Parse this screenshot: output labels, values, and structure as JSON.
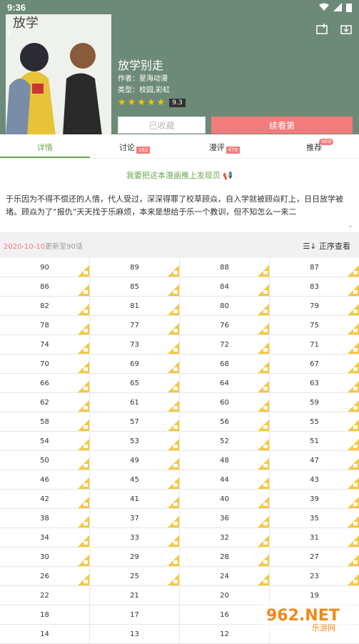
{
  "status": {
    "time": "9:36"
  },
  "header": {
    "title": "放学别走",
    "author": "作者：星海动漫",
    "genre": "类型：校园,彩虹",
    "score": "9.3",
    "fav_label": "已收藏",
    "continue_label": "续看第"
  },
  "tabs": [
    {
      "label": "详情"
    },
    {
      "label": "讨论",
      "badge": "162"
    },
    {
      "label": "漫评",
      "badge": "479"
    },
    {
      "label": "推荐",
      "badge": "NEW"
    }
  ],
  "promo": "我要把这本漫画推上发现页",
  "description": "于乐因为不得不偿还的人情，代人受过，深深得罪了校草顾焱，自入学就被顾焱盯上，日日放学被堵。顾焱为了“报仇”天天找于乐麻烦，本来是想给于乐一个教训，但不知怎么一来二",
  "update": {
    "date": "2020-10-10",
    "text": "更新至90话",
    "sort_label": "正序查看"
  },
  "chapters": [
    [
      "90",
      "89",
      "88",
      "87"
    ],
    [
      "86",
      "85",
      "84",
      "83"
    ],
    [
      "82",
      "81",
      "80",
      "79"
    ],
    [
      "78",
      "77",
      "76",
      "75"
    ],
    [
      "74",
      "73",
      "72",
      "71"
    ],
    [
      "70",
      "69",
      "68",
      "67"
    ],
    [
      "66",
      "65",
      "64",
      "63"
    ],
    [
      "62",
      "61",
      "60",
      "59"
    ],
    [
      "58",
      "57",
      "56",
      "55"
    ],
    [
      "54",
      "53",
      "52",
      "51"
    ],
    [
      "50",
      "49",
      "48",
      "47"
    ],
    [
      "46",
      "45",
      "44",
      "43"
    ],
    [
      "42",
      "41",
      "40",
      "39"
    ],
    [
      "38",
      "37",
      "36",
      "35"
    ],
    [
      "34",
      "33",
      "32",
      "31"
    ],
    [
      "30",
      "29",
      "28",
      "27"
    ],
    [
      "26",
      "25",
      "24",
      "23"
    ],
    [
      "22",
      "21",
      "20",
      "19"
    ],
    [
      "18",
      "17",
      "16",
      ""
    ],
    [
      "14",
      "13",
      "12",
      ""
    ]
  ],
  "locked_rows": 17,
  "watermark": {
    "text": "962.NET",
    "sub": "乐游网"
  }
}
